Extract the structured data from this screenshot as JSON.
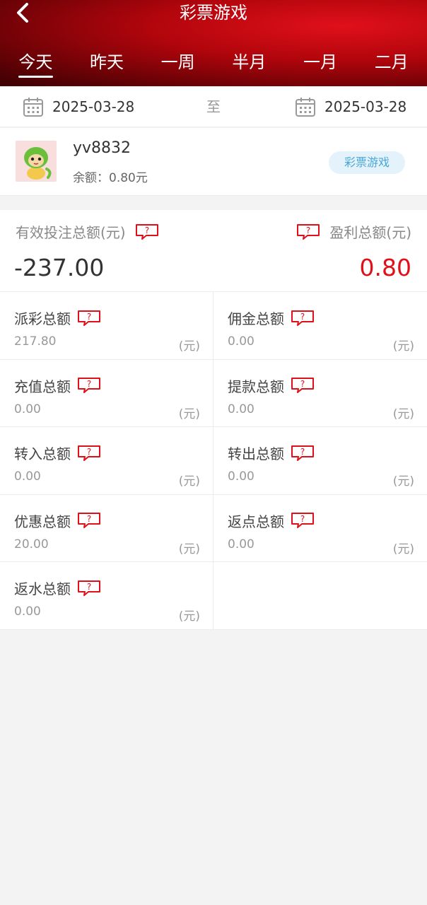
{
  "header": {
    "title": "彩票游戏",
    "tabs": [
      {
        "label": "今天",
        "active": true
      },
      {
        "label": "昨天",
        "active": false
      },
      {
        "label": "一周",
        "active": false
      },
      {
        "label": "半月",
        "active": false
      },
      {
        "label": "一月",
        "active": false
      },
      {
        "label": "二月",
        "active": false
      }
    ]
  },
  "date_range": {
    "start": "2025-03-28",
    "separator": "至",
    "end": "2025-03-28"
  },
  "user": {
    "username": "yv8832",
    "balance_label": "余额：",
    "balance_value": "0.80元",
    "game_tag": "彩票游戏"
  },
  "summary": {
    "bet_label": "有效投注总额(元)",
    "bet_value": "-237.00",
    "profit_label": "盈利总额(元)",
    "profit_value": "0.80"
  },
  "stats": [
    {
      "label": "派彩总额",
      "value": "217.80",
      "unit": "(元)"
    },
    {
      "label": "佣金总额",
      "value": "0.00",
      "unit": "(元)"
    },
    {
      "label": "充值总额",
      "value": "0.00",
      "unit": "(元)"
    },
    {
      "label": "提款总额",
      "value": "0.00",
      "unit": "(元)"
    },
    {
      "label": "转入总额",
      "value": "0.00",
      "unit": "(元)"
    },
    {
      "label": "转出总额",
      "value": "0.00",
      "unit": "(元)"
    },
    {
      "label": "优惠总额",
      "value": "20.00",
      "unit": "(元)"
    },
    {
      "label": "返点总额",
      "value": "0.00",
      "unit": "(元)"
    },
    {
      "label": "返水总额",
      "value": "0.00",
      "unit": "(元)"
    }
  ],
  "colors": {
    "header_red": "#b1050c",
    "profit_red": "#e0101a",
    "tag_blue": "#4aa6d8"
  },
  "icons": {
    "back": "back-arrow-icon",
    "calendar": "calendar-icon",
    "help": "question-bubble-icon"
  }
}
